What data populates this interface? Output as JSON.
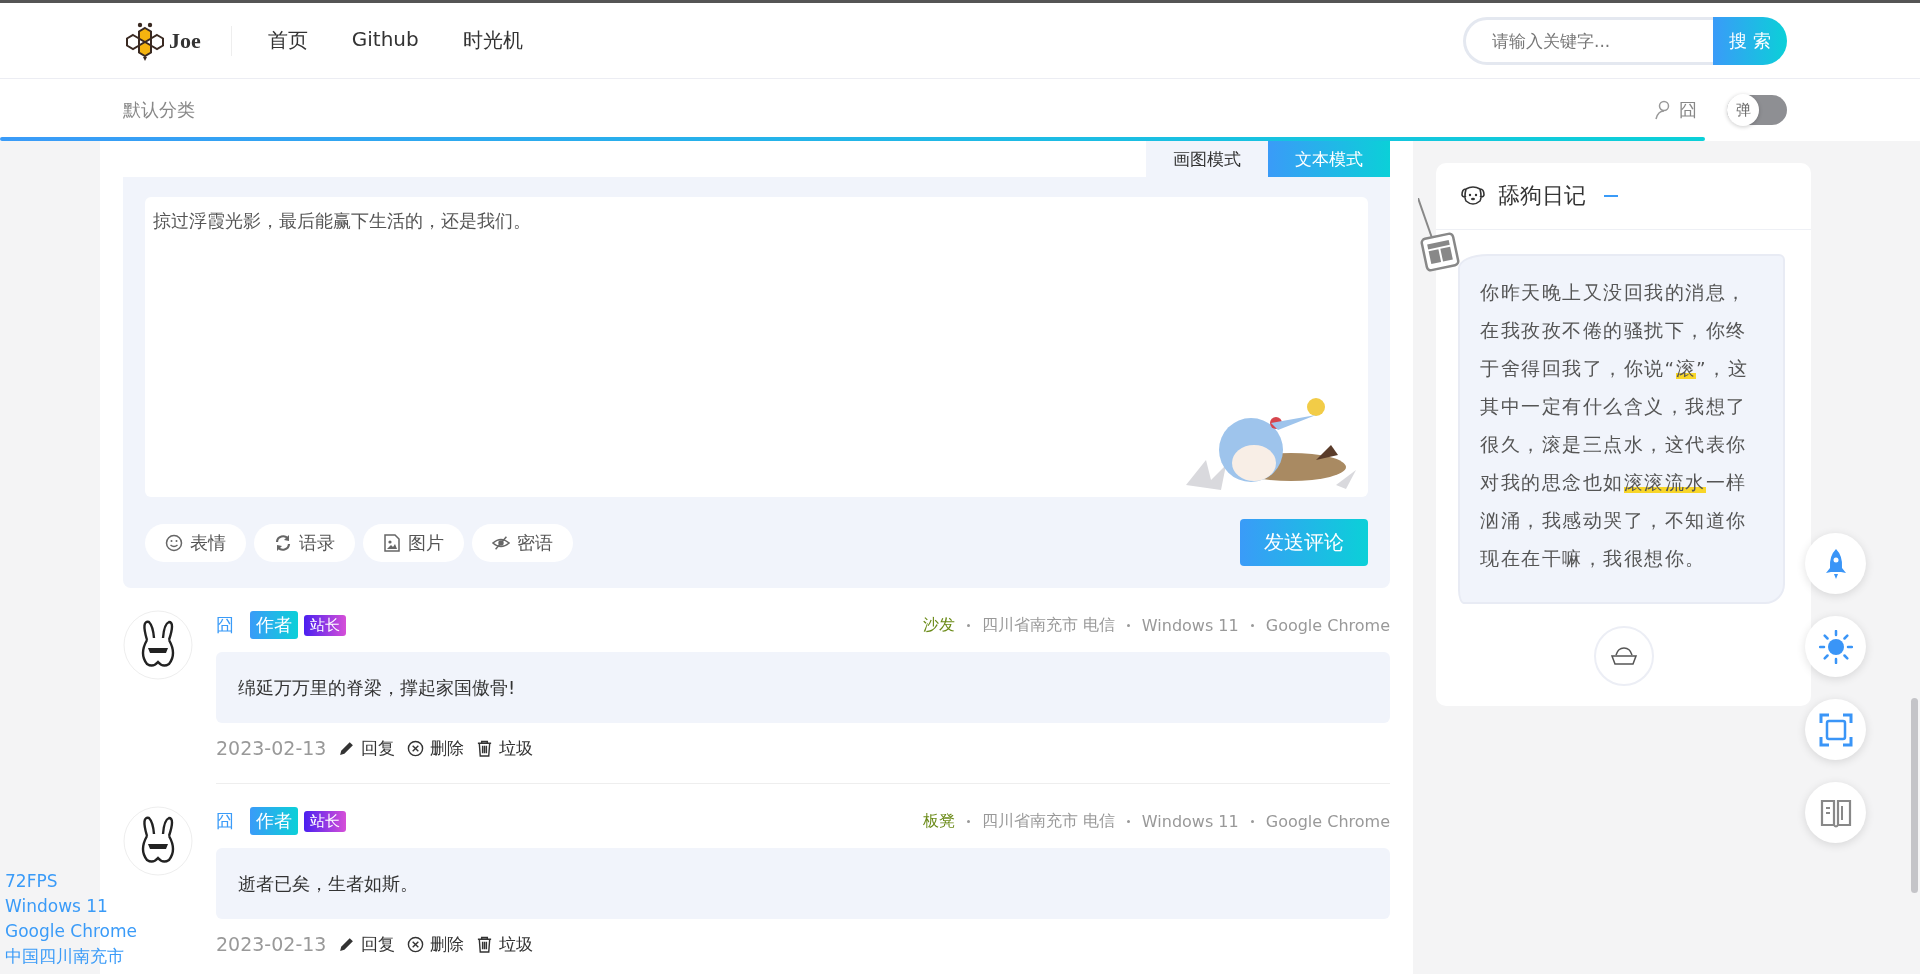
{
  "header": {
    "logo": "Joe",
    "nav": [
      {
        "label": "首页"
      },
      {
        "label": "Github"
      },
      {
        "label": "时光机"
      }
    ],
    "search": {
      "placeholder": "请输入关键字...",
      "button": "搜 索"
    }
  },
  "subheader": {
    "category": "默认分类",
    "user_glyph": "囧",
    "toggle": {
      "label": "弹",
      "on": false
    }
  },
  "progress": {
    "level": 0.888
  },
  "editor": {
    "tabs": [
      {
        "label": "画图模式",
        "selected": false
      },
      {
        "label": "文本模式",
        "selected": true
      }
    ],
    "value": "掠过浮霞光影，最后能赢下生活的，还是我们。",
    "tools": [
      "表情",
      "语录",
      "图片",
      "密语"
    ],
    "submit": "发送评论"
  },
  "comments": [
    {
      "name": "囧",
      "badges": [
        {
          "label": "作者",
          "kind": "author"
        },
        {
          "label": "站长",
          "kind": "admin"
        }
      ],
      "rank": "沙发",
      "meta": [
        "四川省南充市 电信",
        "Windows 11",
        "Google Chrome"
      ],
      "text": "绵延万万里的脊梁，撑起家国傲骨!",
      "date": "2023-02-13",
      "actions": [
        "回复",
        "删除",
        "垃圾"
      ]
    },
    {
      "name": "囧",
      "badges": [
        {
          "label": "作者",
          "kind": "author"
        },
        {
          "label": "站长",
          "kind": "admin"
        }
      ],
      "rank": "板凳",
      "meta": [
        "四川省南充市 电信",
        "Windows 11",
        "Google Chrome"
      ],
      "text": "逝者已矣，生者如斯。",
      "date": "2023-02-13",
      "actions": [
        "回复",
        "删除",
        "垃圾"
      ]
    }
  ],
  "sidebar": {
    "title": "舔狗日记",
    "diary": [
      {
        "text": "你昨天晚上又没回我的消息，在我孜孜不倦的骚扰下，你终于舍得回我了，你说“",
        "highlight": false
      },
      {
        "text": "滚",
        "highlight": true
      },
      {
        "text": "”，这其中一定有什么含义，我想了很久，滚是三点水，这代表你对我的思念也如",
        "highlight": false
      },
      {
        "text": "滚滚流水",
        "highlight": true
      },
      {
        "text": "一样汹涌，我感动哭了，不知道你现在在干嘛，我很想你。",
        "highlight": false
      }
    ]
  },
  "overlay": [
    "72FPS",
    "Windows 11",
    "Google Chrome",
    "中国四川南充市"
  ]
}
